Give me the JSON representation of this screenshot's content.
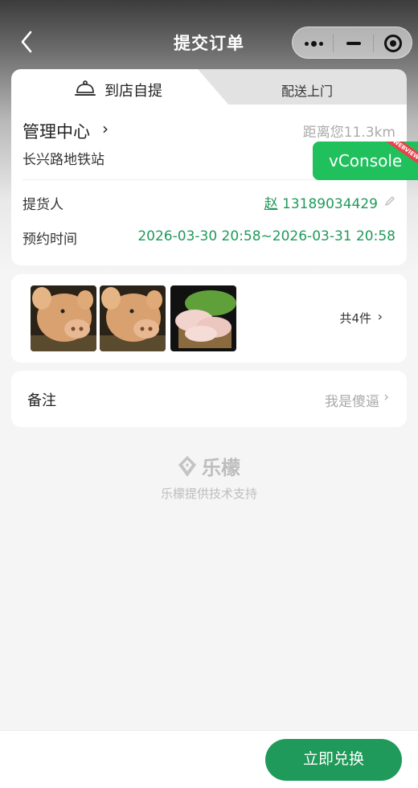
{
  "nav": {
    "title": "提交订单"
  },
  "tabs": {
    "active_label": "到店自提",
    "inactive_label": "配送上门"
  },
  "store": {
    "name": "管理中心",
    "chevron": "›",
    "distance": "距离您11.3km",
    "address": "长兴路地铁站"
  },
  "pickup": {
    "label": "提货人",
    "name": "赵",
    "phone": "13189034429"
  },
  "appointment": {
    "label": "预约时间",
    "value": "2026-03-30 20:58~2026-03-31 20:58"
  },
  "vconsole": {
    "label": "vConsole",
    "ribbon": "WEBVIEW"
  },
  "goods": {
    "count_label": "共4件",
    "chevron": "›",
    "thumbnails": [
      "pig-face-image",
      "pig-face-image",
      "pig-trotters-image"
    ]
  },
  "remark": {
    "label": "备注",
    "value": "我是傻逼",
    "chevron": "›"
  },
  "brand": {
    "name": "乐檬",
    "support": "乐檬提供技术支持"
  },
  "footer": {
    "submit_label": "立即兑换"
  },
  "colors": {
    "accent": "#1f9a5a",
    "vconsole": "#20c05c",
    "ribbon": "#e8434b"
  }
}
